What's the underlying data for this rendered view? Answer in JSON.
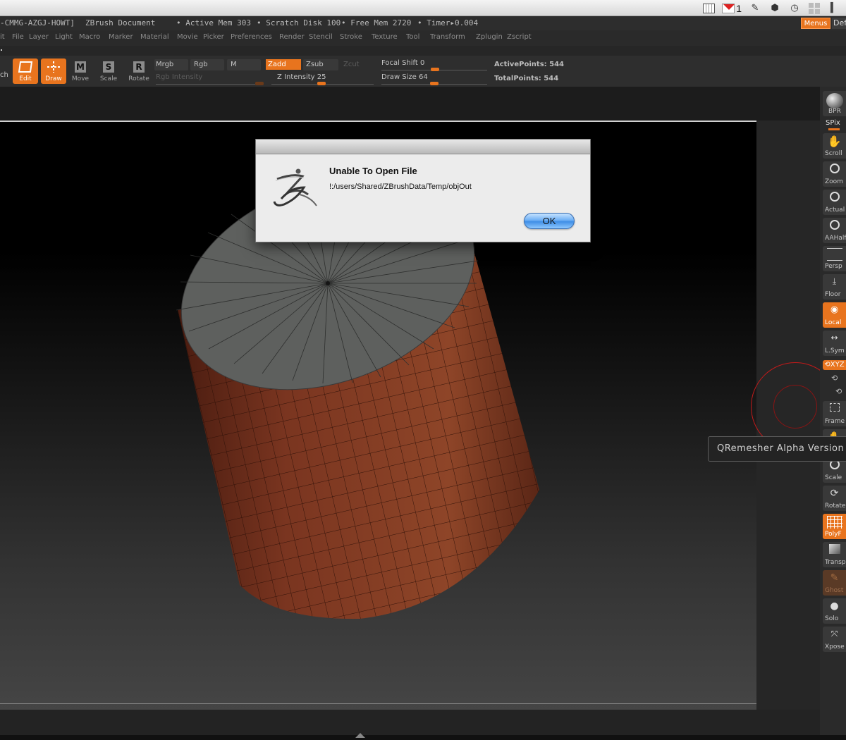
{
  "system_tray": {
    "mail_count": "1"
  },
  "title_bar": {
    "serial": "-CMMG-AZGJ-HOWT]",
    "document": "ZBrush Document",
    "active_mem": "• Active Mem 303",
    "scratch_disk": "• Scratch Disk 100",
    "free_mem": "• Free Mem 2720",
    "timer": "• Timer▸0.004",
    "menus_button": "Menus",
    "default_button": "Def"
  },
  "menu_bar": {
    "items": [
      "it",
      "File",
      "Layer",
      "Light",
      "Macro",
      "Marker",
      "Material",
      "Movie",
      "Picker",
      "Preferences",
      "Render",
      "Stencil",
      "Stroke",
      "Texture",
      "Tool",
      "Transform",
      "Zplugin",
      "Zscript"
    ]
  },
  "shelf": {
    "truncated": "ch",
    "edit": "Edit",
    "draw": "Draw",
    "move": "Move",
    "scale": "Scale",
    "rotate": "Rotate",
    "move_letter": "M",
    "scale_letter": "S",
    "rotate_letter": "R",
    "mrgb": "Mrgb",
    "rgb": "Rgb",
    "m": "M",
    "rgb_intensity": "Rgb Intensity",
    "zadd": "Zadd",
    "zsub": "Zsub",
    "zcut": "Zcut",
    "z_intensity": "Z Intensity 25",
    "focal_shift": "Focal Shift 0",
    "draw_size": "Draw Size 64",
    "active_points": "ActivePoints: 544",
    "total_points": "TotalPoints: 544"
  },
  "right_tools": {
    "bpr": "BPR",
    "spix": "SPix",
    "scroll": "Scroll",
    "zoom": "Zoom",
    "actual": "Actual",
    "aahalf": "AAHalf",
    "persp": "Persp",
    "floor": "Floor",
    "local": "Local",
    "lsym": "L.Sym",
    "xyz": "⟲XYZ",
    "frame": "Frame",
    "scale": "Scale",
    "rotate": "Rotate",
    "polyf": "PolyF",
    "transp": "Transp",
    "ghost": "Ghost",
    "solo": "Solo",
    "xpose": "Xpose"
  },
  "tooltip": {
    "text": "QRemesher Alpha Version"
  },
  "dialog": {
    "title": "Unable To Open File",
    "message": "!:/users/Shared/ZBrushData/Temp/objOut",
    "ok": "OK"
  },
  "colors": {
    "accent": "#e8741e",
    "cylinder_side": "#7a3a22",
    "cylinder_top": "#5e605e"
  }
}
